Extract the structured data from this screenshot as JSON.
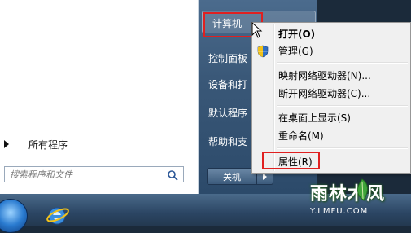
{
  "start_menu": {
    "left": {
      "all_programs": "所有程序",
      "search_placeholder": "搜索程序和文件"
    },
    "right": {
      "items": [
        "计算机",
        "控制面板",
        "设备和打",
        "默认程序",
        "帮助和支"
      ],
      "shutdown_label": "关机"
    }
  },
  "context_menu": {
    "items": {
      "open": "打开(O)",
      "manage": "管理(G)",
      "map_drive": "映射网络驱动器(N)...",
      "disconnect_drive": "断开网络驱动器(C)...",
      "show_desktop": "在桌面上显示(S)",
      "rename": "重命名(M)",
      "properties": "属性(R)"
    }
  },
  "watermark": {
    "title": "雨林木风",
    "url": "Y.LMFU.COM"
  },
  "colors": {
    "highlight_red": "#e02020",
    "menu_bg": "#f0f0f0",
    "start_panel_dark": "#3a5878"
  },
  "icons": [
    "search-icon",
    "shield-icon",
    "cursor-arrow-icon",
    "start-orb-icon",
    "ie-icon",
    "leaf-icon"
  ]
}
